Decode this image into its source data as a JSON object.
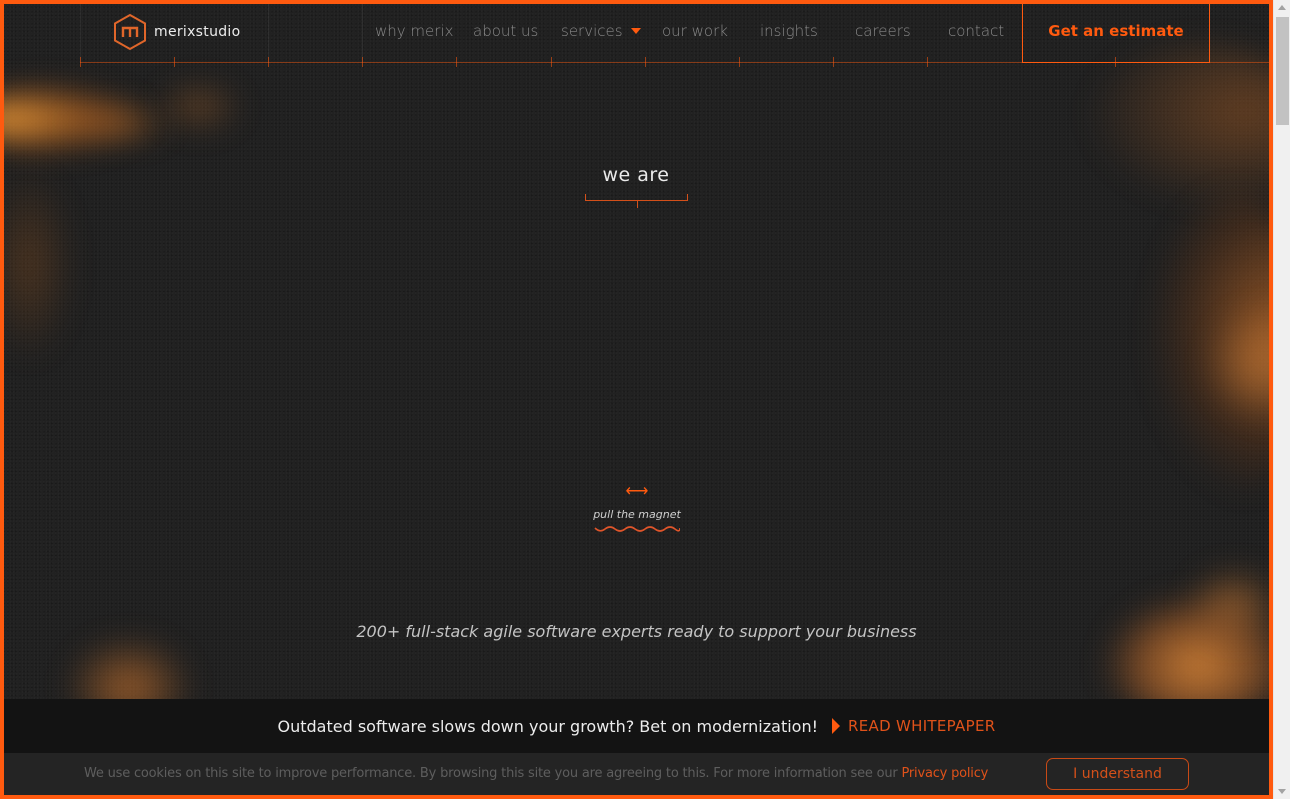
{
  "brand": {
    "name": "merixstudio",
    "accent_color": "#ff5a0f",
    "logo_icon": "hexagon-m-icon"
  },
  "nav": {
    "items": [
      {
        "label": "why merix"
      },
      {
        "label": "about us"
      },
      {
        "label": "services",
        "has_dropdown": true
      },
      {
        "label": "our work"
      },
      {
        "label": "insights"
      },
      {
        "label": "careers"
      },
      {
        "label": "contact"
      }
    ],
    "cta_label": "Get an estimate"
  },
  "hero": {
    "heading": "we are",
    "magnet_icon": "double-arrow-icon",
    "magnet_label": "pull the magnet",
    "tagline": "200+ full-stack agile software experts ready to support your business"
  },
  "promo": {
    "text": "Outdated software slows down your growth? Bet on modernization!",
    "link_label": "READ WHITEPAPER"
  },
  "cookie": {
    "text": "We use cookies on this site to improve performance. By browsing this site you are agreeing to this. For more information see our",
    "link_label": "Privacy policy",
    "button_label": "I understand"
  }
}
